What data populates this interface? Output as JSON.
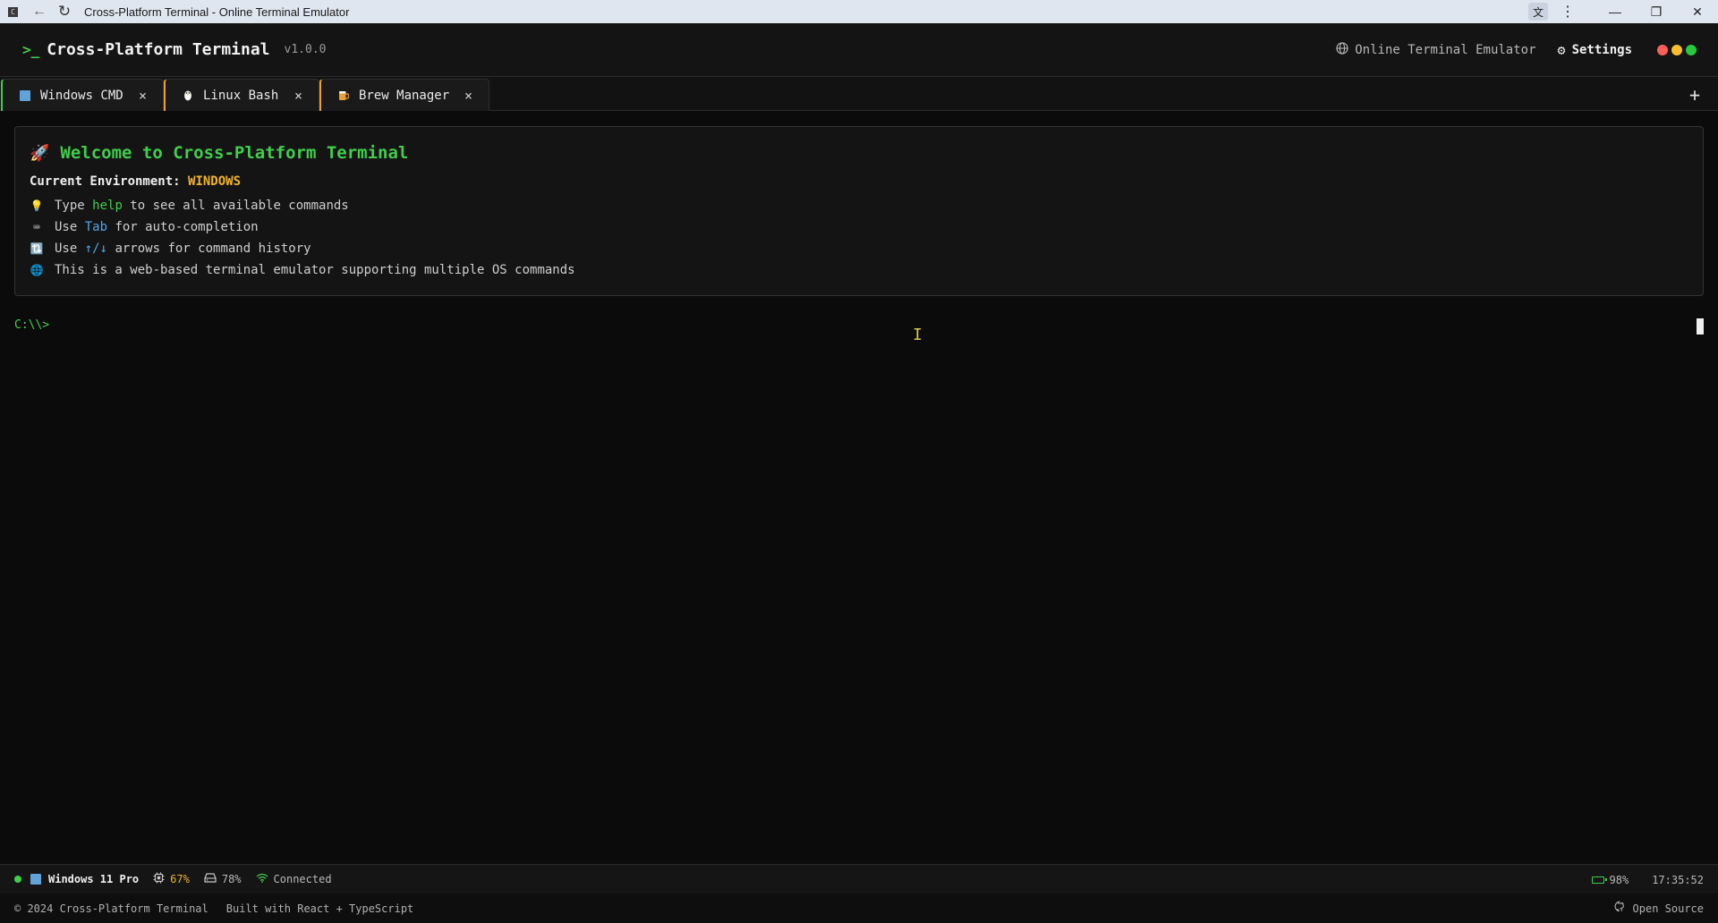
{
  "browser": {
    "app_icon": "C",
    "title": "Cross-Platform Terminal - Online Terminal Emulator"
  },
  "header": {
    "logo": ">_",
    "app_name": "Cross-Platform Terminal",
    "version": "v1.0.0",
    "link": "Online Terminal Emulator",
    "settings": "Settings",
    "dot_colors": [
      "#ff5f56",
      "#ffbd2e",
      "#27c93f"
    ]
  },
  "tabs": [
    {
      "label": "Windows CMD",
      "icon": "windows-icon",
      "accent": "#3fcf4a"
    },
    {
      "label": "Linux Bash",
      "icon": "penguin-icon",
      "accent": "#f0a030"
    },
    {
      "label": "Brew Manager",
      "icon": "beer-icon",
      "accent": "#f0a030"
    }
  ],
  "welcome": {
    "title": "Welcome to Cross-Platform Terminal",
    "env_label": "Current Environment:",
    "env_value": "WINDOWS",
    "tips": [
      {
        "icon": "lightbulb-icon",
        "pre": "Type ",
        "kw": "help",
        "post": " to see all available commands"
      },
      {
        "icon": "keyboard-icon",
        "pre": "Use ",
        "kw": "Tab",
        "post": " for auto-completion"
      },
      {
        "icon": "arrows-icon",
        "pre": "Use ",
        "kw": "↑/↓",
        "post": " arrows for command history"
      },
      {
        "icon": "globe-icon",
        "pre": "",
        "kw": "",
        "post": "This is a web-based terminal emulator supporting multiple OS commands"
      }
    ]
  },
  "terminal": {
    "prompt": "C:\\\\>"
  },
  "status": {
    "os": "Windows 11 Pro",
    "cpu": "67%",
    "memory": "78%",
    "connection": "Connected",
    "battery": "98%",
    "time": "17:35:52"
  },
  "footer": {
    "copyright": "© 2024 Cross-Platform Terminal",
    "built": "Built with React + TypeScript",
    "open_source": "Open Source"
  },
  "colors": {
    "accent_green": "#3fcf4a",
    "accent_yellow": "#f0b429",
    "accent_blue": "#4fa8e8"
  }
}
